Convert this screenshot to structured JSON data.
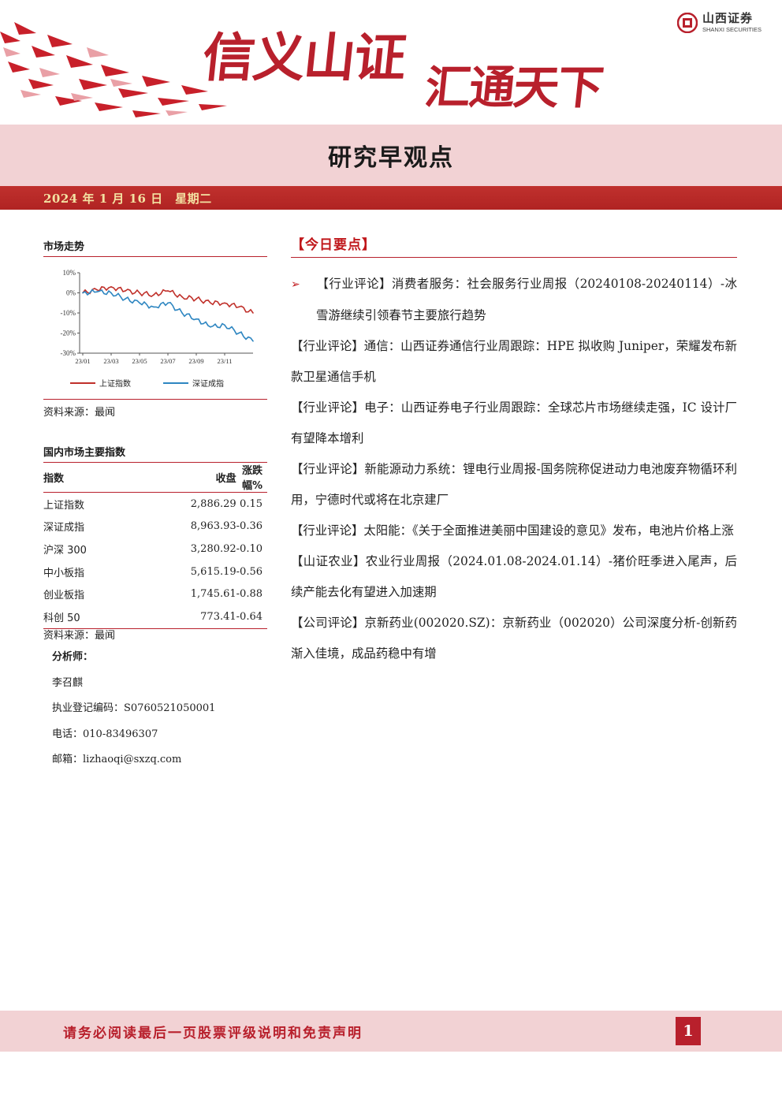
{
  "header": {
    "slogan_part1": "信义山证",
    "slogan_part2": "汇通天下",
    "logo_cn": "山西证券",
    "logo_en": "SHANXI SECURITIES",
    "colors": {
      "brand_red": "#b8202c",
      "band_pink": "#f2d2d4",
      "date_gold": "#f3e2a2"
    }
  },
  "title": "研究早观点",
  "date": "2024 年 1 月 16 日　星期二",
  "left": {
    "market_trend_title": "市场走势",
    "market_source": "资料来源：最闻",
    "index_table_title": "国内市场主要指数",
    "index_table": {
      "headers": [
        "指数",
        "收盘",
        "涨跌幅%"
      ],
      "rows": [
        [
          "上证指数",
          "2,886.29",
          "0.15"
        ],
        [
          "深证成指",
          "8,963.93",
          "-0.36"
        ],
        [
          "沪深 300",
          "3,280.92",
          "-0.10"
        ],
        [
          "中小板指",
          "5,615.19",
          "-0.56"
        ],
        [
          "创业板指",
          "1,745.61",
          "-0.88"
        ],
        [
          "科创 50",
          "773.41",
          "-0.64"
        ]
      ]
    },
    "index_source": "资料来源：最闻",
    "analyst": {
      "label": "分析师：",
      "name": "李召麒",
      "license": "执业登记编码：S0760521050001",
      "phone": "电话：010-83496307",
      "email": "邮箱：lizhaoqi@sxzq.com"
    }
  },
  "chart_data": {
    "type": "line",
    "x": [
      "23/01",
      "23/02",
      "23/03",
      "23/04",
      "23/05",
      "23/06",
      "23/07",
      "23/08",
      "23/09",
      "23/10",
      "23/11",
      "23/12",
      "24/01"
    ],
    "x_tick_labels": [
      "23/01",
      "23/03",
      "23/05",
      "23/07",
      "23/09",
      "23/11"
    ],
    "y_tick_labels": [
      "10%",
      "0%",
      "-10%",
      "-20%",
      "-30%"
    ],
    "ylim": [
      -30,
      10
    ],
    "grid": false,
    "legend_position": "bottom",
    "series": [
      {
        "name": "上证指数",
        "color": "#c0302a",
        "values": [
          0,
          1.5,
          3,
          1,
          0,
          -1,
          1,
          -2,
          -3,
          -5,
          -5,
          -7,
          -10
        ]
      },
      {
        "name": "深证成指",
        "color": "#2e86c1",
        "values": [
          0,
          0.5,
          0,
          -3,
          -5,
          -7,
          -5,
          -10,
          -13,
          -17,
          -16,
          -20,
          -24
        ]
      }
    ]
  },
  "right": {
    "today_head": "【今日要点】",
    "bullet_glyph": "➢",
    "points": [
      "【行业评论】消费者服务：社会服务行业周报（20240108-20240114）-冰雪游继续引领春节主要旅行趋势",
      "【行业评论】通信：山西证券通信行业周跟踪：HPE 拟收购 Juniper，荣耀发布新款卫星通信手机",
      "【行业评论】电子：山西证券电子行业周跟踪：全球芯片市场继续走强，IC 设计厂有望降本增利",
      "【行业评论】新能源动力系统：锂电行业周报-国务院称促进动力电池废弃物循环利用，宁德时代或将在北京建厂",
      "【行业评论】太阳能：《关于全面推进美丽中国建设的意见》发布，电池片价格上涨",
      "【山证农业】农业行业周报（2024.01.08-2024.01.14）-猪价旺季进入尾声，后续产能去化有望进入加速期",
      "【公司评论】京新药业(002020.SZ)：京新药业（002020）公司深度分析-创新药渐入佳境，成品药稳中有增"
    ]
  },
  "footer": {
    "notice": "请务必阅读最后一页股票评级说明和免责声明",
    "page": "1"
  }
}
